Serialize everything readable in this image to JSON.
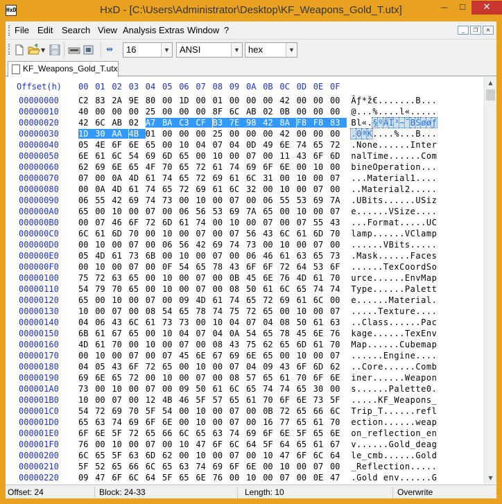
{
  "window": {
    "title": "HxD - [C:\\Users\\Administrator\\Desktop\\KF_Weapons_Gold_T.utx]",
    "app_icon_text": "HxD",
    "minimize": "—",
    "maximize": "☐",
    "close": "✕"
  },
  "menu": {
    "items": [
      "File",
      "Edit",
      "Search",
      "View",
      "Analysis",
      "Extras",
      "Window",
      "?"
    ],
    "mdi_minimize": "_",
    "mdi_restore": "❐",
    "mdi_close": "✕"
  },
  "toolbar": {
    "bytes_per_row": "16",
    "charset": "ANSI",
    "offset_base": "hex"
  },
  "tab": {
    "label": "KF_Weapons_Gold_T.utx"
  },
  "hex": {
    "header_offset": "Offset(h)",
    "header_columns": [
      "00",
      "01",
      "02",
      "03",
      "04",
      "05",
      "06",
      "07",
      "08",
      "09",
      "0A",
      "0B",
      "0C",
      "0D",
      "0E",
      "0F"
    ],
    "rows": [
      {
        "offset": "00000000",
        "bytes": [
          "C2",
          "83",
          "2A",
          "9E",
          "80",
          "00",
          "1D",
          "00",
          "01",
          "00",
          "00",
          "00",
          "42",
          "00",
          "00",
          "00"
        ],
        "ascii": "Âƒ*ž€.......B..."
      },
      {
        "offset": "00000010",
        "bytes": [
          "40",
          "00",
          "00",
          "00",
          "25",
          "00",
          "00",
          "00",
          "8F",
          "6C",
          "AB",
          "02",
          "0B",
          "00",
          "00",
          "00"
        ],
        "ascii": "@...%....l«....."
      },
      {
        "offset": "00000020",
        "bytes": [
          "42",
          "6C",
          "AB",
          "02",
          "A7",
          "BA",
          "C3",
          "CF",
          "B3",
          "7E",
          "98",
          "42",
          "8A",
          "F8",
          "F8",
          "83"
        ],
        "ascii": "Bl«.§ºÃÏ³~˜BŠøøƒ"
      },
      {
        "offset": "00000030",
        "bytes": [
          "1D",
          "30",
          "AA",
          "4B",
          "01",
          "00",
          "00",
          "00",
          "25",
          "00",
          "00",
          "00",
          "42",
          "00",
          "00",
          "00"
        ],
        "ascii": ".0ªK....%...B..."
      },
      {
        "offset": "00000040",
        "bytes": [
          "05",
          "4E",
          "6F",
          "6E",
          "65",
          "00",
          "10",
          "04",
          "07",
          "04",
          "0D",
          "49",
          "6E",
          "74",
          "65",
          "72"
        ],
        "ascii": ".None......Inter"
      },
      {
        "offset": "00000050",
        "bytes": [
          "6E",
          "61",
          "6C",
          "54",
          "69",
          "6D",
          "65",
          "00",
          "10",
          "00",
          "07",
          "00",
          "11",
          "43",
          "6F",
          "6D"
        ],
        "ascii": "nalTime......Com"
      },
      {
        "offset": "00000060",
        "bytes": [
          "62",
          "69",
          "6E",
          "65",
          "4F",
          "70",
          "65",
          "72",
          "61",
          "74",
          "69",
          "6F",
          "6E",
          "00",
          "10",
          "00"
        ],
        "ascii": "bineOperation..."
      },
      {
        "offset": "00000070",
        "bytes": [
          "07",
          "00",
          "0A",
          "4D",
          "61",
          "74",
          "65",
          "72",
          "69",
          "61",
          "6C",
          "31",
          "00",
          "10",
          "00",
          "07"
        ],
        "ascii": "...Material1...."
      },
      {
        "offset": "00000080",
        "bytes": [
          "00",
          "0A",
          "4D",
          "61",
          "74",
          "65",
          "72",
          "69",
          "61",
          "6C",
          "32",
          "00",
          "10",
          "00",
          "07",
          "00"
        ],
        "ascii": "..Material2....."
      },
      {
        "offset": "00000090",
        "bytes": [
          "06",
          "55",
          "42",
          "69",
          "74",
          "73",
          "00",
          "10",
          "00",
          "07",
          "00",
          "06",
          "55",
          "53",
          "69",
          "7A"
        ],
        "ascii": ".UBits......USiz"
      },
      {
        "offset": "000000A0",
        "bytes": [
          "65",
          "00",
          "10",
          "00",
          "07",
          "00",
          "06",
          "56",
          "53",
          "69",
          "7A",
          "65",
          "00",
          "10",
          "00",
          "07"
        ],
        "ascii": "e......VSize...."
      },
      {
        "offset": "000000B0",
        "bytes": [
          "00",
          "07",
          "46",
          "6F",
          "72",
          "6D",
          "61",
          "74",
          "00",
          "10",
          "00",
          "07",
          "00",
          "07",
          "55",
          "43"
        ],
        "ascii": "...Format.....UC"
      },
      {
        "offset": "000000C0",
        "bytes": [
          "6C",
          "61",
          "6D",
          "70",
          "00",
          "10",
          "00",
          "07",
          "00",
          "07",
          "56",
          "43",
          "6C",
          "61",
          "6D",
          "70"
        ],
        "ascii": "lamp......VClamp"
      },
      {
        "offset": "000000D0",
        "bytes": [
          "00",
          "10",
          "00",
          "07",
          "00",
          "06",
          "56",
          "42",
          "69",
          "74",
          "73",
          "00",
          "10",
          "00",
          "07",
          "00"
        ],
        "ascii": "......VBits....."
      },
      {
        "offset": "000000E0",
        "bytes": [
          "05",
          "4D",
          "61",
          "73",
          "6B",
          "00",
          "10",
          "00",
          "07",
          "00",
          "06",
          "46",
          "61",
          "63",
          "65",
          "73"
        ],
        "ascii": ".Mask......Faces"
      },
      {
        "offset": "000000F0",
        "bytes": [
          "00",
          "10",
          "00",
          "07",
          "00",
          "0F",
          "54",
          "65",
          "78",
          "43",
          "6F",
          "6F",
          "72",
          "64",
          "53",
          "6F"
        ],
        "ascii": "......TexCoordSo"
      },
      {
        "offset": "00000100",
        "bytes": [
          "75",
          "72",
          "63",
          "65",
          "00",
          "10",
          "00",
          "07",
          "00",
          "0B",
          "45",
          "6E",
          "76",
          "4D",
          "61",
          "70"
        ],
        "ascii": "urce......EnvMap"
      },
      {
        "offset": "00000110",
        "bytes": [
          "54",
          "79",
          "70",
          "65",
          "00",
          "10",
          "00",
          "07",
          "00",
          "08",
          "50",
          "61",
          "6C",
          "65",
          "74",
          "74"
        ],
        "ascii": "Type......Palett"
      },
      {
        "offset": "00000120",
        "bytes": [
          "65",
          "00",
          "10",
          "00",
          "07",
          "00",
          "09",
          "4D",
          "61",
          "74",
          "65",
          "72",
          "69",
          "61",
          "6C",
          "00"
        ],
        "ascii": "e......Material."
      },
      {
        "offset": "00000130",
        "bytes": [
          "10",
          "00",
          "07",
          "00",
          "08",
          "54",
          "65",
          "78",
          "74",
          "75",
          "72",
          "65",
          "00",
          "10",
          "00",
          "07"
        ],
        "ascii": ".....Texture...."
      },
      {
        "offset": "00000140",
        "bytes": [
          "04",
          "06",
          "43",
          "6C",
          "61",
          "73",
          "73",
          "00",
          "10",
          "04",
          "07",
          "04",
          "08",
          "50",
          "61",
          "63"
        ],
        "ascii": "..Class......Pac"
      },
      {
        "offset": "00000150",
        "bytes": [
          "6B",
          "61",
          "67",
          "65",
          "00",
          "10",
          "04",
          "07",
          "04",
          "0A",
          "54",
          "65",
          "78",
          "45",
          "6E",
          "76"
        ],
        "ascii": "kage......TexEnv"
      },
      {
        "offset": "00000160",
        "bytes": [
          "4D",
          "61",
          "70",
          "00",
          "10",
          "00",
          "07",
          "00",
          "08",
          "43",
          "75",
          "62",
          "65",
          "6D",
          "61",
          "70"
        ],
        "ascii": "Map......Cubemap"
      },
      {
        "offset": "00000170",
        "bytes": [
          "00",
          "10",
          "00",
          "07",
          "00",
          "07",
          "45",
          "6E",
          "67",
          "69",
          "6E",
          "65",
          "00",
          "10",
          "00",
          "07"
        ],
        "ascii": "......Engine...."
      },
      {
        "offset": "00000180",
        "bytes": [
          "04",
          "05",
          "43",
          "6F",
          "72",
          "65",
          "00",
          "10",
          "00",
          "07",
          "04",
          "09",
          "43",
          "6F",
          "6D",
          "62"
        ],
        "ascii": "..Core......Comb"
      },
      {
        "offset": "00000190",
        "bytes": [
          "69",
          "6E",
          "65",
          "72",
          "00",
          "10",
          "00",
          "07",
          "00",
          "08",
          "57",
          "65",
          "61",
          "70",
          "6F",
          "6E"
        ],
        "ascii": "iner......Weapon"
      },
      {
        "offset": "000001A0",
        "bytes": [
          "73",
          "00",
          "10",
          "00",
          "07",
          "00",
          "09",
          "50",
          "61",
          "6C",
          "65",
          "74",
          "74",
          "65",
          "30",
          "00"
        ],
        "ascii": "s......Palette0."
      },
      {
        "offset": "000001B0",
        "bytes": [
          "10",
          "00",
          "07",
          "00",
          "12",
          "4B",
          "46",
          "5F",
          "57",
          "65",
          "61",
          "70",
          "6F",
          "6E",
          "73",
          "5F"
        ],
        "ascii": ".....KF_Weapons_"
      },
      {
        "offset": "000001C0",
        "bytes": [
          "54",
          "72",
          "69",
          "70",
          "5F",
          "54",
          "00",
          "10",
          "00",
          "07",
          "00",
          "0B",
          "72",
          "65",
          "66",
          "6C"
        ],
        "ascii": "Trip_T......refl"
      },
      {
        "offset": "000001D0",
        "bytes": [
          "65",
          "63",
          "74",
          "69",
          "6F",
          "6E",
          "00",
          "10",
          "00",
          "07",
          "00",
          "16",
          "77",
          "65",
          "61",
          "70"
        ],
        "ascii": "ection......weap"
      },
      {
        "offset": "000001E0",
        "bytes": [
          "6F",
          "6E",
          "5F",
          "72",
          "65",
          "66",
          "6C",
          "65",
          "63",
          "74",
          "69",
          "6F",
          "6E",
          "5F",
          "65",
          "6E"
        ],
        "ascii": "on_reflection_en"
      },
      {
        "offset": "000001F0",
        "bytes": [
          "76",
          "00",
          "10",
          "00",
          "07",
          "00",
          "10",
          "47",
          "6F",
          "6C",
          "64",
          "5F",
          "64",
          "65",
          "61",
          "67"
        ],
        "ascii": "v......Gold_deag"
      },
      {
        "offset": "00000200",
        "bytes": [
          "6C",
          "65",
          "5F",
          "63",
          "6D",
          "62",
          "00",
          "10",
          "00",
          "07",
          "00",
          "10",
          "47",
          "6F",
          "6C",
          "64"
        ],
        "ascii": "le_cmb......Gold"
      },
      {
        "offset": "00000210",
        "bytes": [
          "5F",
          "52",
          "65",
          "66",
          "6C",
          "65",
          "63",
          "74",
          "69",
          "6F",
          "6E",
          "00",
          "10",
          "00",
          "07",
          "00"
        ],
        "ascii": "_Reflection....."
      },
      {
        "offset": "00000220",
        "bytes": [
          "09",
          "47",
          "6F",
          "6C",
          "64",
          "5F",
          "65",
          "6E",
          "76",
          "00",
          "10",
          "00",
          "07",
          "00",
          "0E",
          "47"
        ],
        "ascii": ".Gold env......G"
      }
    ],
    "selection": {
      "row_start": 2,
      "col_start": 4,
      "row_end": 3,
      "col_end": 3
    }
  },
  "status": {
    "offset": "Offset: 24",
    "block": "Block: 24-33",
    "length": "Length: 10",
    "mode": "Overwrite"
  }
}
